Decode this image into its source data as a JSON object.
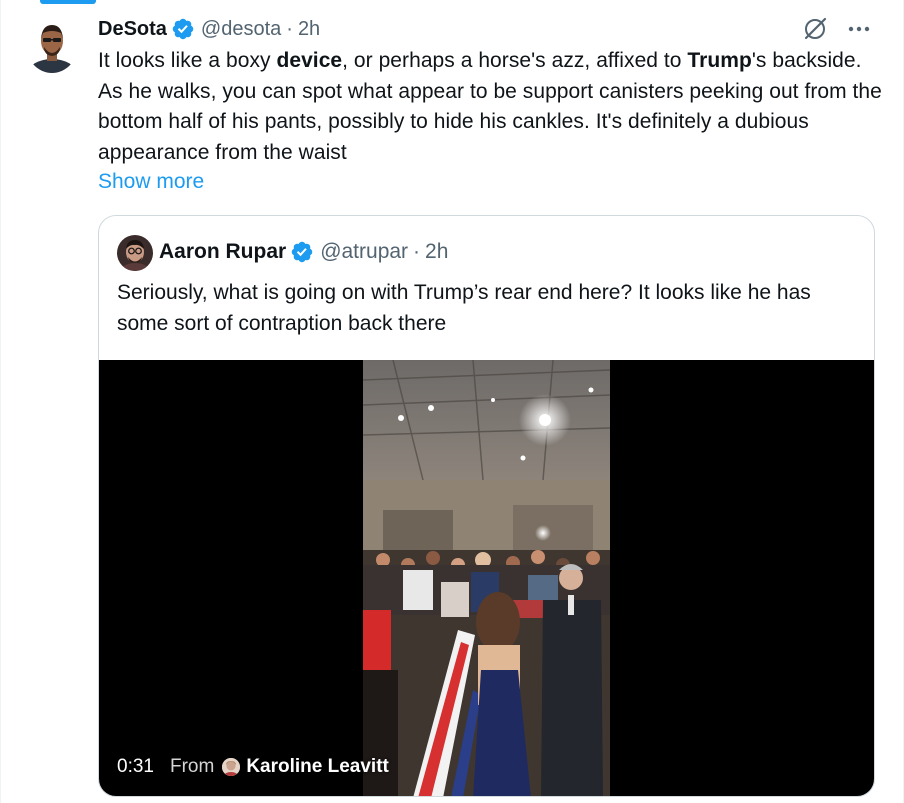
{
  "tweet": {
    "display_name": "DeSota",
    "handle": "@desota",
    "separator": "·",
    "time": "2h",
    "text_segments": [
      "It looks like a boxy ",
      "device",
      ", or perhaps a horse's azz, affixed to ",
      "Trump",
      "'s backside. As he walks, you can spot what appear to be support canisters peeking out from the bottom half of his pants, possibly to hide his cankles. It's definitely a dubious appearance from the waist"
    ],
    "show_more": "Show more"
  },
  "quoted": {
    "display_name": "Aaron Rupar",
    "handle": "@atrupar",
    "separator": "·",
    "time": "2h",
    "text": "Seriously, what is going on with Trump’s rear end here? It looks like he has some sort of contraption back there",
    "media": {
      "duration": "0:31",
      "from_label": "From",
      "source_name": "Karoline Leavitt"
    }
  },
  "icons": {
    "verified": "verified-badge-icon",
    "grok": "grok-icon",
    "more": "more-options-icon"
  },
  "colors": {
    "accent": "#1d9bf0",
    "text": "#0f1419",
    "muted": "#536471",
    "border": "#cfd9de"
  }
}
